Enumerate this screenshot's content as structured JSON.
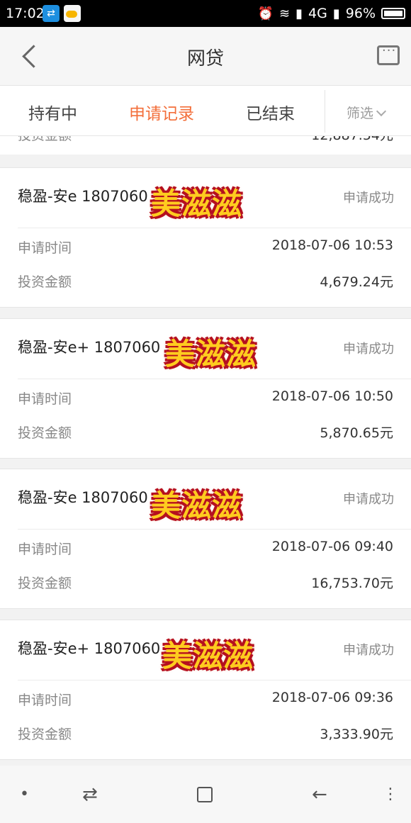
{
  "status_bar": {
    "time": "17:02",
    "network": "4G",
    "battery": "96%"
  },
  "header": {
    "title": "网贷"
  },
  "tabs": {
    "holding": "持有中",
    "apply_records": "申请记录",
    "finished": "已结束",
    "filter": "筛选"
  },
  "partial_row": {
    "label": "投资金额",
    "value": "12,887.54元"
  },
  "records": [
    {
      "name": "稳盈-安e 1807060",
      "status": "申请成功",
      "time_label": "申请时间",
      "time": "2018-07-06 10:53",
      "amount_label": "投资金额",
      "amount": "4,679.24元"
    },
    {
      "name": "稳盈-安e+ 1807060",
      "status": "申请成功",
      "time_label": "申请时间",
      "time": "2018-07-06 10:50",
      "amount_label": "投资金额",
      "amount": "5,870.65元"
    },
    {
      "name": "稳盈-安e 1807060",
      "status": "申请成功",
      "time_label": "申请时间",
      "time": "2018-07-06 09:40",
      "amount_label": "投资金额",
      "amount": "16,753.70元"
    },
    {
      "name": "稳盈-安e+ 1807060",
      "status": "申请成功",
      "time_label": "申请时间",
      "time": "2018-07-06 09:36",
      "amount_label": "投资金额",
      "amount": "3,333.90元"
    }
  ],
  "sticker": "美滋滋"
}
